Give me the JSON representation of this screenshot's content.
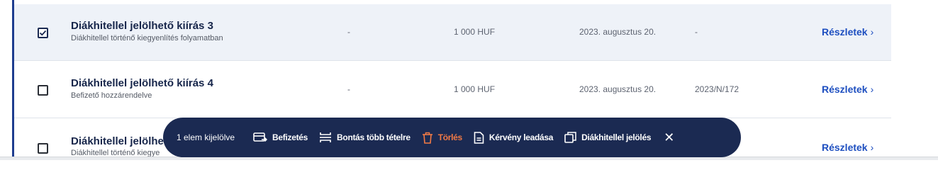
{
  "rows": [
    {
      "checked": true,
      "title": "Diákhitellel jelölhető kiírás 3",
      "subtitle": "Diákhitellel történő kiegyenlítés folyamatban",
      "col_a": "-",
      "amount": "1 000 HUF",
      "date": "2023. augusztus 20.",
      "ref": "-",
      "details_label": "Részletek"
    },
    {
      "checked": false,
      "title": "Diákhitellel jelölhető kiírás 4",
      "subtitle": "Befizető hozzárendelve",
      "col_a": "-",
      "amount": "1 000 HUF",
      "date": "2023. augusztus 20.",
      "ref": "2023/N/172",
      "details_label": "Részletek"
    },
    {
      "checked": false,
      "title": "Diákhitellel jelölhe",
      "subtitle": "Diákhitellel történő kiegye",
      "details_label": "Részletek"
    }
  ],
  "action_bar": {
    "selection_count": "1 elem kijelölve",
    "actions": [
      {
        "label": "Befizetés",
        "icon": "payment-icon"
      },
      {
        "label": "Bontás több tételre",
        "icon": "split-icon"
      },
      {
        "label": "Törlés",
        "icon": "trash-icon"
      },
      {
        "label": "Kérvény leadása",
        "icon": "document-icon"
      },
      {
        "label": "Diákhitellel jelölés",
        "icon": "mark-icon"
      }
    ],
    "close_icon": "close-icon"
  },
  "colors": {
    "accent": "#1e3d8f",
    "link": "#1e4fc0",
    "bar_bg": "#1b2a52",
    "danger": "#f27a45",
    "selected_row": "#eef2f8"
  }
}
